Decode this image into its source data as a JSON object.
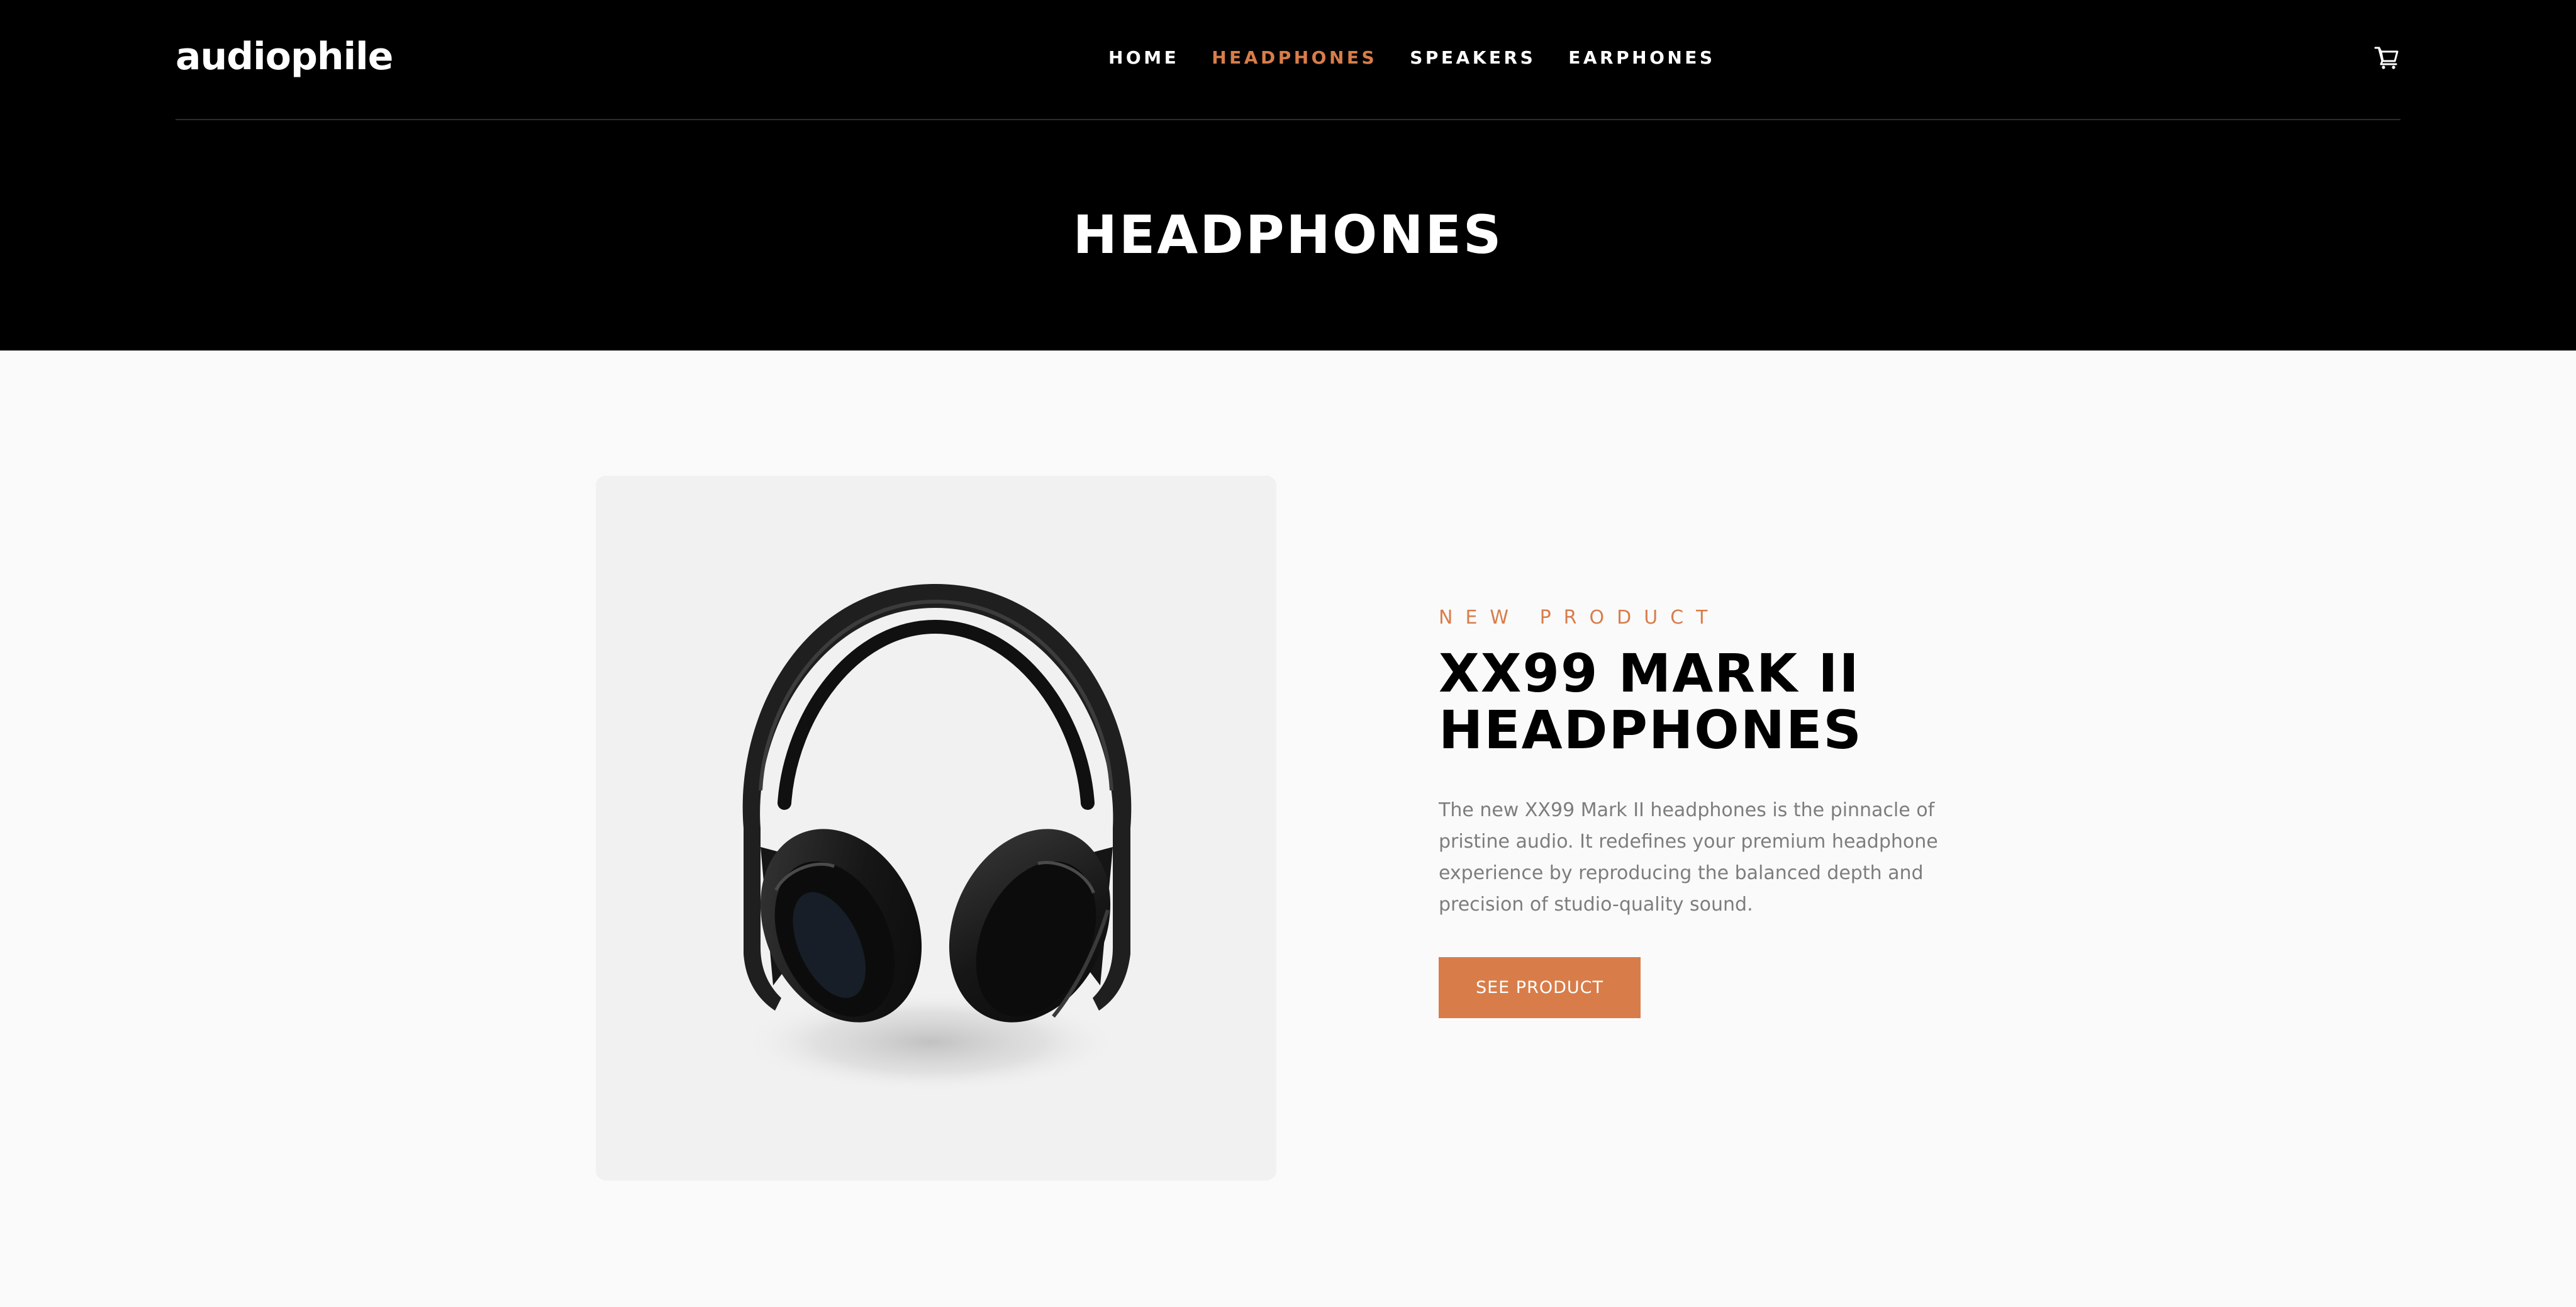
{
  "header": {
    "logo": "audiophile",
    "nav": [
      {
        "label": "HOME",
        "active": false
      },
      {
        "label": "HEADPHONES",
        "active": true
      },
      {
        "label": "SPEAKERS",
        "active": false
      },
      {
        "label": "EARPHONES",
        "active": false
      }
    ],
    "cart_icon": "cart-icon",
    "page_title": "HEADPHONES"
  },
  "product": {
    "overline": "NEW PRODUCT",
    "name": "XX99 MARK II HEADPHONES",
    "description": "The new XX99 Mark II headphones is the pinnacle of pristine audio. It redefines your premium headphone experience by reproducing the balanced depth and precision of studio-quality sound.",
    "button_label": "SEE PRODUCT"
  },
  "colors": {
    "accent": "#D87D4A",
    "header_bg": "#000000",
    "page_bg": "#FAFAFA",
    "image_bg": "#F1F1F1",
    "body_text": "#7D7D7D"
  }
}
